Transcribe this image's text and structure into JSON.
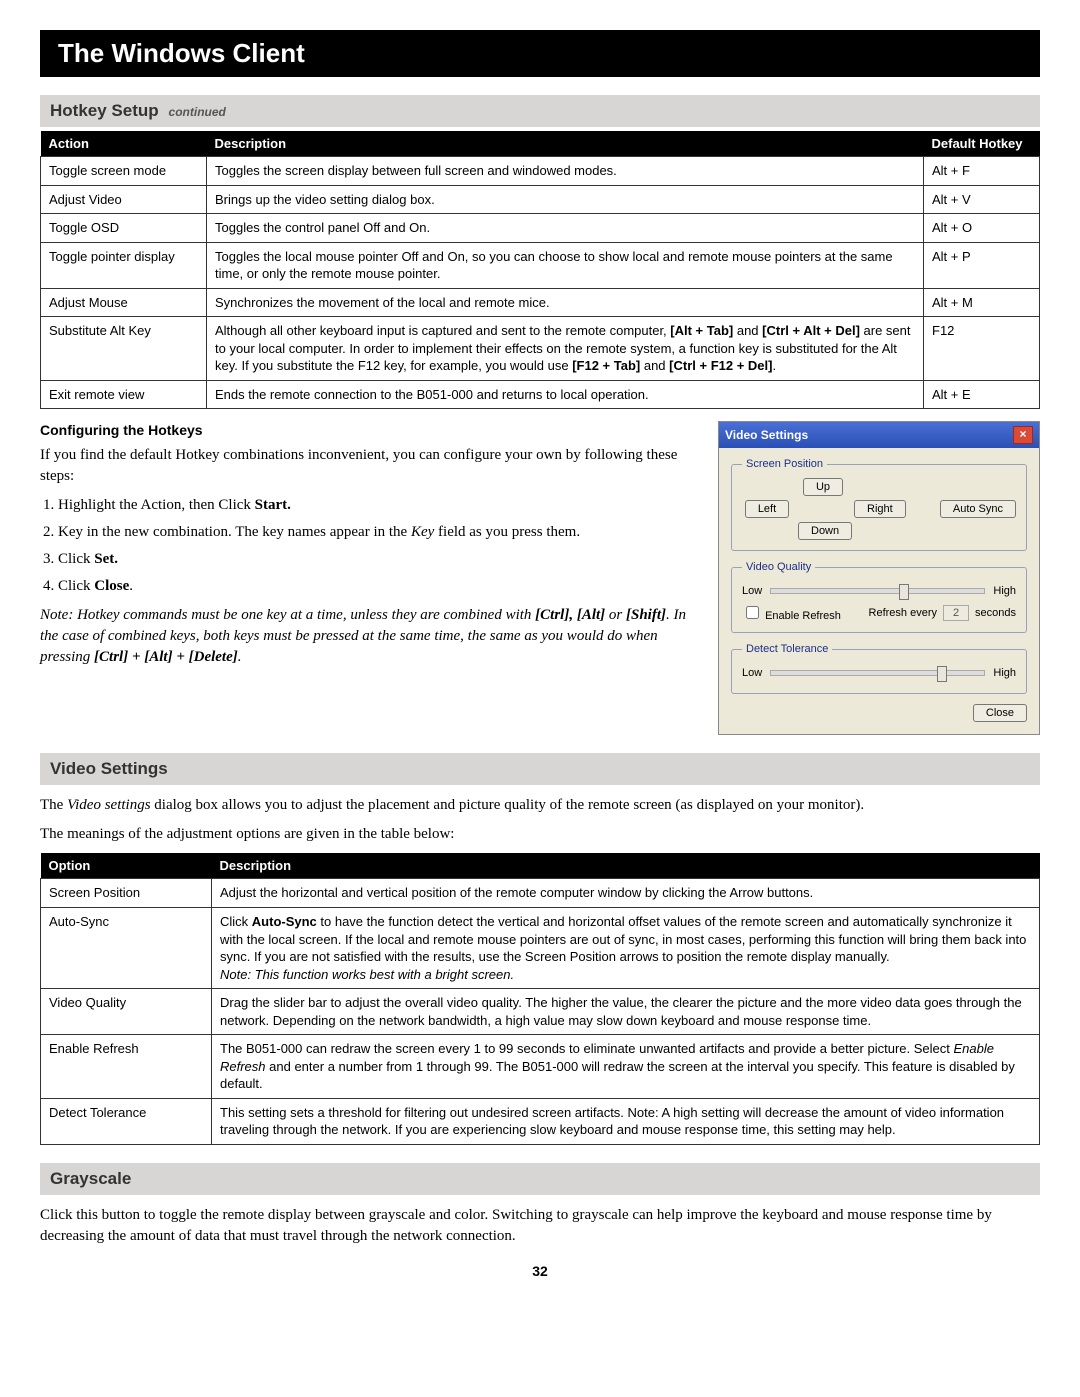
{
  "page_title": "The Windows Client",
  "page_number": "32",
  "hotkey_section": {
    "heading": "Hotkey Setup",
    "suffix": "continued",
    "headers": {
      "action": "Action",
      "description": "Description",
      "hotkey": "Default Hotkey"
    },
    "rows": [
      {
        "action": "Toggle screen mode",
        "description": "Toggles the screen display between full screen and windowed modes.",
        "hotkey": "Alt + F"
      },
      {
        "action": "Adjust Video",
        "description": "Brings up the video setting dialog box.",
        "hotkey": "Alt + V"
      },
      {
        "action": "Toggle OSD",
        "description": "Toggles the control panel Off and On.",
        "hotkey": "Alt + O"
      },
      {
        "action": "Toggle pointer display",
        "description": "Toggles the local mouse pointer Off and On, so you can choose to show local and remote mouse pointers at the same time, or only the remote mouse pointer.",
        "hotkey": "Alt + P"
      },
      {
        "action": "Adjust Mouse",
        "description": "Synchronizes the movement of the local and remote mice.",
        "hotkey": "Alt + M"
      },
      {
        "action": "Substitute Alt Key",
        "description_html": "Although all other keyboard input is captured and sent to the remote computer, <b>[Alt + Tab]</b> and <b>[Ctrl + Alt + Del]</b> are sent to your local computer. In order to implement their effects on the remote system, a function key is substituted for the Alt key. If you substitute the F12 key, for example, you would use <b>[F12 + Tab]</b> and <b>[Ctrl + F12 + Del]</b>.",
        "hotkey": "F12"
      },
      {
        "action": "Exit remote view",
        "description": "Ends the remote connection to the B051-000 and returns to local operation.",
        "hotkey": "Alt + E"
      }
    ]
  },
  "config_section": {
    "subhead": "Configuring the Hotkeys",
    "intro": "If you find the default Hotkey combinations inconvenient, you can configure your own by following these steps:",
    "steps": [
      "Highlight the Action, then Click <b>Start.</b>",
      "Key in the new combination. The key names appear in the <i>Key</i> field as you press them.",
      "Click <b>Set.</b>",
      "Click <b>Close</b>."
    ],
    "note_html": "<i>Note: Hotkey commands must be one key at a time, unless they are combined with</i> <b>[Ctrl], [Alt]</b> <i>or</i> <b>[Shift]</b><i>. In the case of combined keys, both keys must be pressed at the same time, the same as you would do when pressing</i> <b>[Ctrl] + [Alt] + [Delete]</b><i>.</i>"
  },
  "dialog": {
    "title": "Video Settings",
    "groups": {
      "position": "Screen Position",
      "quality": "Video Quality",
      "tolerance": "Detect Tolerance"
    },
    "buttons": {
      "up": "Up",
      "down": "Down",
      "left": "Left",
      "right": "Right",
      "auto": "Auto Sync",
      "close": "Close"
    },
    "labels": {
      "low": "Low",
      "high": "High",
      "enable_refresh": "Enable Refresh",
      "refresh_every": "Refresh every",
      "seconds": "seconds"
    },
    "refresh_value": "2"
  },
  "video_section": {
    "heading": "Video Settings",
    "intro_html": "The <i>Video settings</i> dialog box allows you to adjust the placement and picture quality of the remote screen (as displayed on your monitor).",
    "intro2": "The meanings of the adjustment options are given in the table below:",
    "headers": {
      "option": "Option",
      "description": "Description"
    },
    "rows": [
      {
        "option": "Screen Position",
        "description": "Adjust the horizontal and vertical position of the remote computer window by clicking the Arrow buttons."
      },
      {
        "option": "Auto-Sync",
        "description_html": "Click <b>Auto-Sync</b> to have the function detect the vertical and horizontal offset values of the remote screen and automatically synchronize it with the local screen. If the local and remote mouse pointers are out of sync, in most cases, performing this function will bring them back into sync. If you are not satisfied with the results, use the Screen Position arrows to position the remote display manually.<br><span class='autosync-note'>Note: This function works best with a bright screen.</span>"
      },
      {
        "option": "Video Quality",
        "description": "Drag the slider bar to adjust the overall video quality. The higher the value, the clearer the picture and the more video data goes through the network. Depending on the network bandwidth, a high value may slow down keyboard and mouse response time."
      },
      {
        "option": "Enable Refresh",
        "description_html": "The B051-000 can redraw the screen every 1 to 99 seconds to eliminate unwanted artifacts and provide a better picture. Select <i>Enable Refresh</i> and enter a number from 1 through 99. The B051-000 will redraw the screen at the interval you specify. This feature is disabled by default."
      },
      {
        "option": "Detect Tolerance",
        "description": "This setting sets a threshold for filtering out undesired screen artifacts. Note: A high setting will decrease the amount of video information traveling through the network. If you are experiencing slow keyboard and mouse response time, this setting may help."
      }
    ]
  },
  "grayscale_section": {
    "heading": "Grayscale",
    "body": "Click this button to toggle the remote display between grayscale and color. Switching to grayscale can help improve the keyboard and mouse response time by decreasing the amount of data that must travel through the network connection."
  }
}
